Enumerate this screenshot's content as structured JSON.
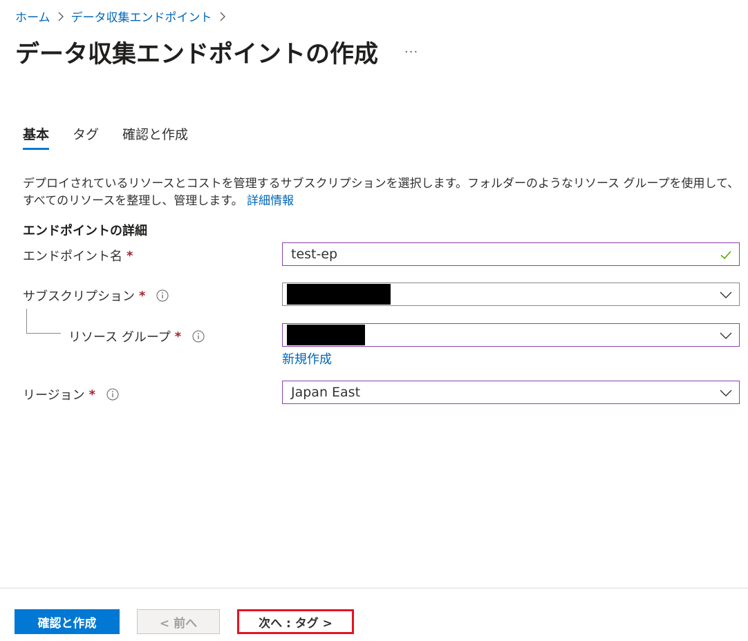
{
  "breadcrumb": {
    "items": [
      "ホーム",
      "データ収集エンドポイント"
    ]
  },
  "header": {
    "title": "データ収集エンドポイントの作成",
    "more": "···"
  },
  "tabs": [
    {
      "label": "基本",
      "active": true
    },
    {
      "label": "タグ",
      "active": false
    },
    {
      "label": "確認と作成",
      "active": false
    }
  ],
  "description": {
    "text": "デプロイされているリソースとコストを管理するサブスクリプションを選択します。フォルダーのようなリソース グループを使用して、すべてのリソースを整理し、管理します。",
    "link": "詳細情報"
  },
  "section": {
    "heading": "エンドポイントの詳細"
  },
  "form": {
    "required_mark": "*",
    "endpoint_name": {
      "label": "エンドポイント名",
      "value": "test-ep"
    },
    "subscription": {
      "label": "サブスクリプション",
      "value": ""
    },
    "resource_group": {
      "label": "リソース グループ",
      "value": "",
      "create_new": "新規作成"
    },
    "region": {
      "label": "リージョン",
      "value": "Japan East"
    }
  },
  "footer": {
    "review_create": "確認と作成",
    "prev": "< 前へ",
    "next": "次へ : タグ >"
  },
  "colors": {
    "accent": "#0078d4",
    "link": "#0067b8",
    "required": "#a4262c",
    "field_border": "#8a3fa8",
    "valid_check": "#57a300",
    "highlight": "#e81123"
  }
}
